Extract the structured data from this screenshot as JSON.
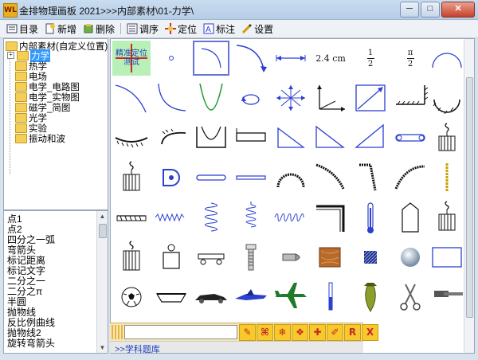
{
  "window": {
    "title": "金排物理画板 2021>>>内部素材\\01-力学\\",
    "app_icon": "WL",
    "controls": {
      "minimize": "─",
      "maximize": "□",
      "close": "✕"
    }
  },
  "toolbar": {
    "items": [
      {
        "icon": "catalog-icon",
        "label": "目录"
      },
      {
        "icon": "new-icon",
        "label": "新增"
      },
      {
        "icon": "delete-icon",
        "label": "删除"
      },
      {
        "icon": "reorder-icon",
        "label": "调序"
      },
      {
        "icon": "locate-icon",
        "label": "定位"
      },
      {
        "icon": "annotate-icon",
        "label": "标注"
      },
      {
        "icon": "settings-icon",
        "label": "设置"
      }
    ]
  },
  "tree": {
    "root": "内部素材(自定义位置)",
    "items": [
      "力学",
      "热学",
      "电场",
      "电学_电路图",
      "电学_实物图",
      "磁学_简图",
      "光学",
      "实验",
      "振动和波"
    ],
    "selected_index": 0
  },
  "list": {
    "items": [
      "点1",
      "点2",
      "四分之一弧",
      "弯箭头",
      "标记距离",
      "标记文字",
      "二分之一",
      "二分之π",
      "半圆",
      "抛物线",
      "反比例曲线",
      "抛物线2",
      "旋转弯箭头"
    ]
  },
  "grid": {
    "first_tile_text": "精准定位测试",
    "distance_label": "2.4 cm",
    "fraction_half": {
      "num": "1",
      "den": "2"
    },
    "fraction_pi_half": {
      "num": "π",
      "den": "2"
    }
  },
  "bottombar": {
    "tool_icons": [
      "pen-icon",
      "command-icon",
      "snowflake-icon",
      "flower-icon",
      "plus-icon",
      "edit-icon",
      "R",
      "X"
    ],
    "tab_label": ">>学科题库"
  },
  "colors": {
    "accent_blue": "#2b3fd0",
    "selection": "#3399ff",
    "toolbar_yellow": "#f7c92b"
  }
}
